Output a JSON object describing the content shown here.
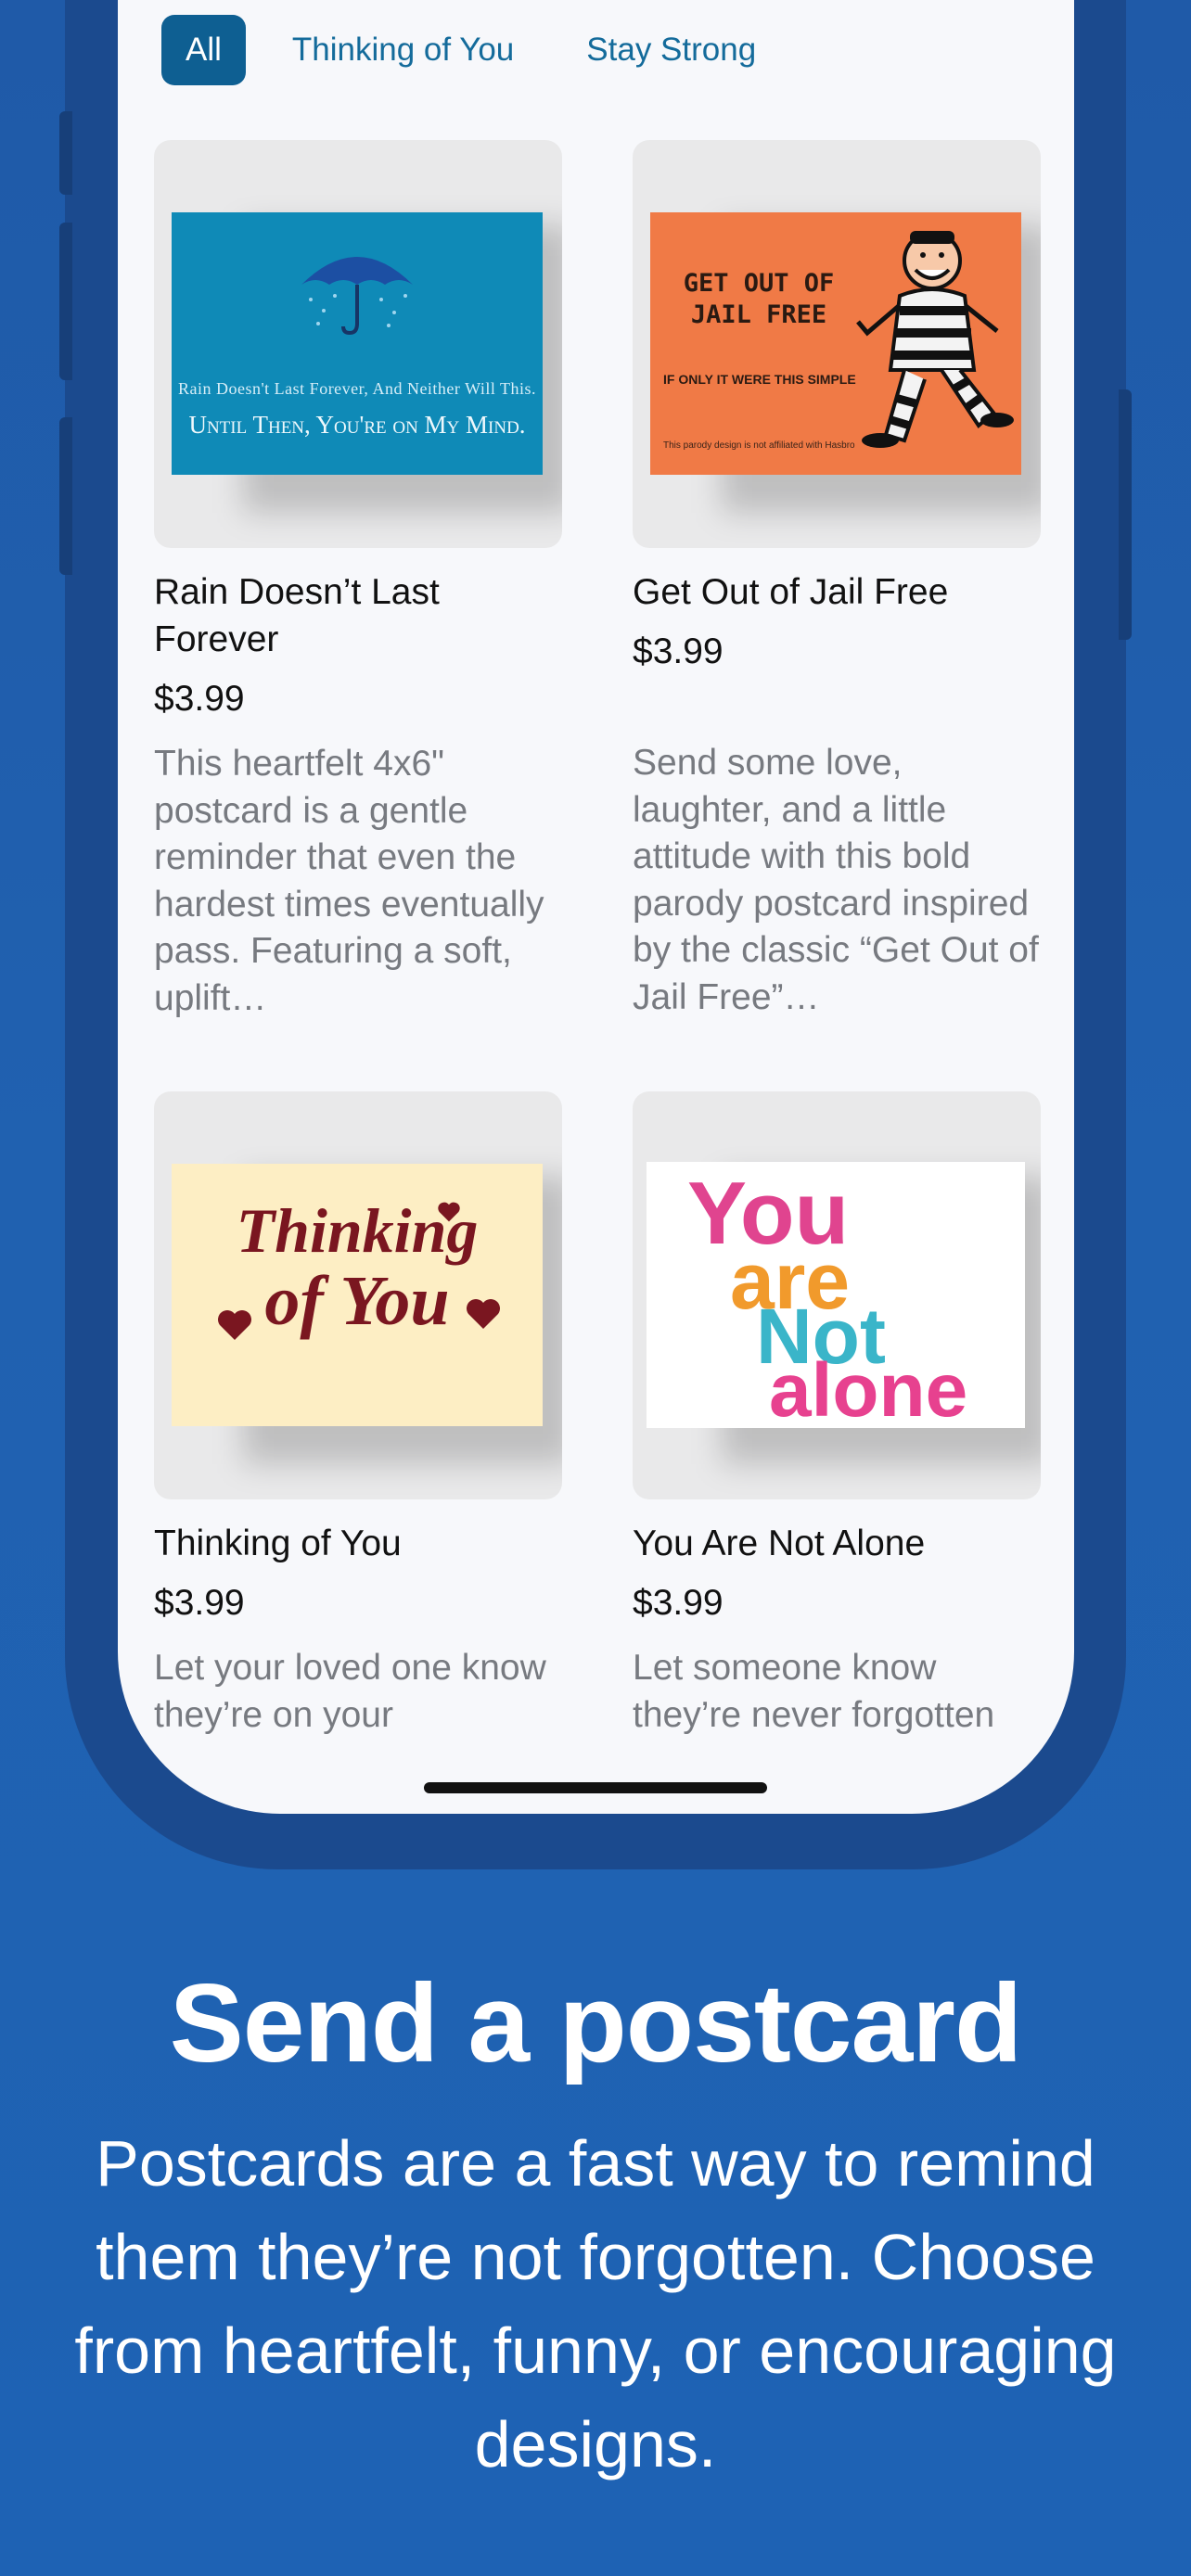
{
  "filters": {
    "chips": [
      "All",
      "Thinking of You",
      "Stay Strong"
    ],
    "active_index": 0
  },
  "cards": [
    {
      "title": "Rain Doesn’t Last Forever",
      "price": "$3.99",
      "description": "This heartfelt 4x6\" postcard is a gentle reminder that even the hardest times eventually pass. Featuring a soft, uplift…",
      "art": {
        "line1": "Rain Doesn't Last Forever, And Neither Will This.",
        "line2": "Until Then, You're on My Mind.",
        "bg_color": "#0f8ab7"
      }
    },
    {
      "title": "Get Out of Jail Free",
      "price": "$3.99",
      "description": "Send some love, laughter, and a little attitude with this bold parody postcard inspired by the classic “Get Out of Jail Free”…",
      "art": {
        "headline": "GET OUT OF JAIL FREE",
        "tagline": "IF ONLY IT WERE THIS SIMPLE",
        "disclaimer": "This parody design is not affiliated with Hasbro",
        "bg_color": "#f07a46"
      }
    },
    {
      "title": "Thinking of You",
      "price": "$3.99",
      "description": "Let your loved one know they’re on your",
      "art": {
        "line1": "Thinking",
        "line2": "of You",
        "bg_color": "#fdeec4"
      }
    },
    {
      "title": "You Are Not Alone",
      "price": "$3.99",
      "description": "Let someone know they’re never forgotten",
      "art": {
        "words": [
          "You",
          "are",
          "Not",
          "alone"
        ],
        "bg_color": "#ffffff"
      }
    }
  ],
  "marketing": {
    "headline": "Send a postcard",
    "subhead": "Postcards are a fast way to remind them they’re not forgotten. Choose from heartfelt, funny, or encouraging designs."
  },
  "colors": {
    "background": "#1f5aa8",
    "accent": "#0e5f92",
    "chip_text": "#146b9b"
  }
}
